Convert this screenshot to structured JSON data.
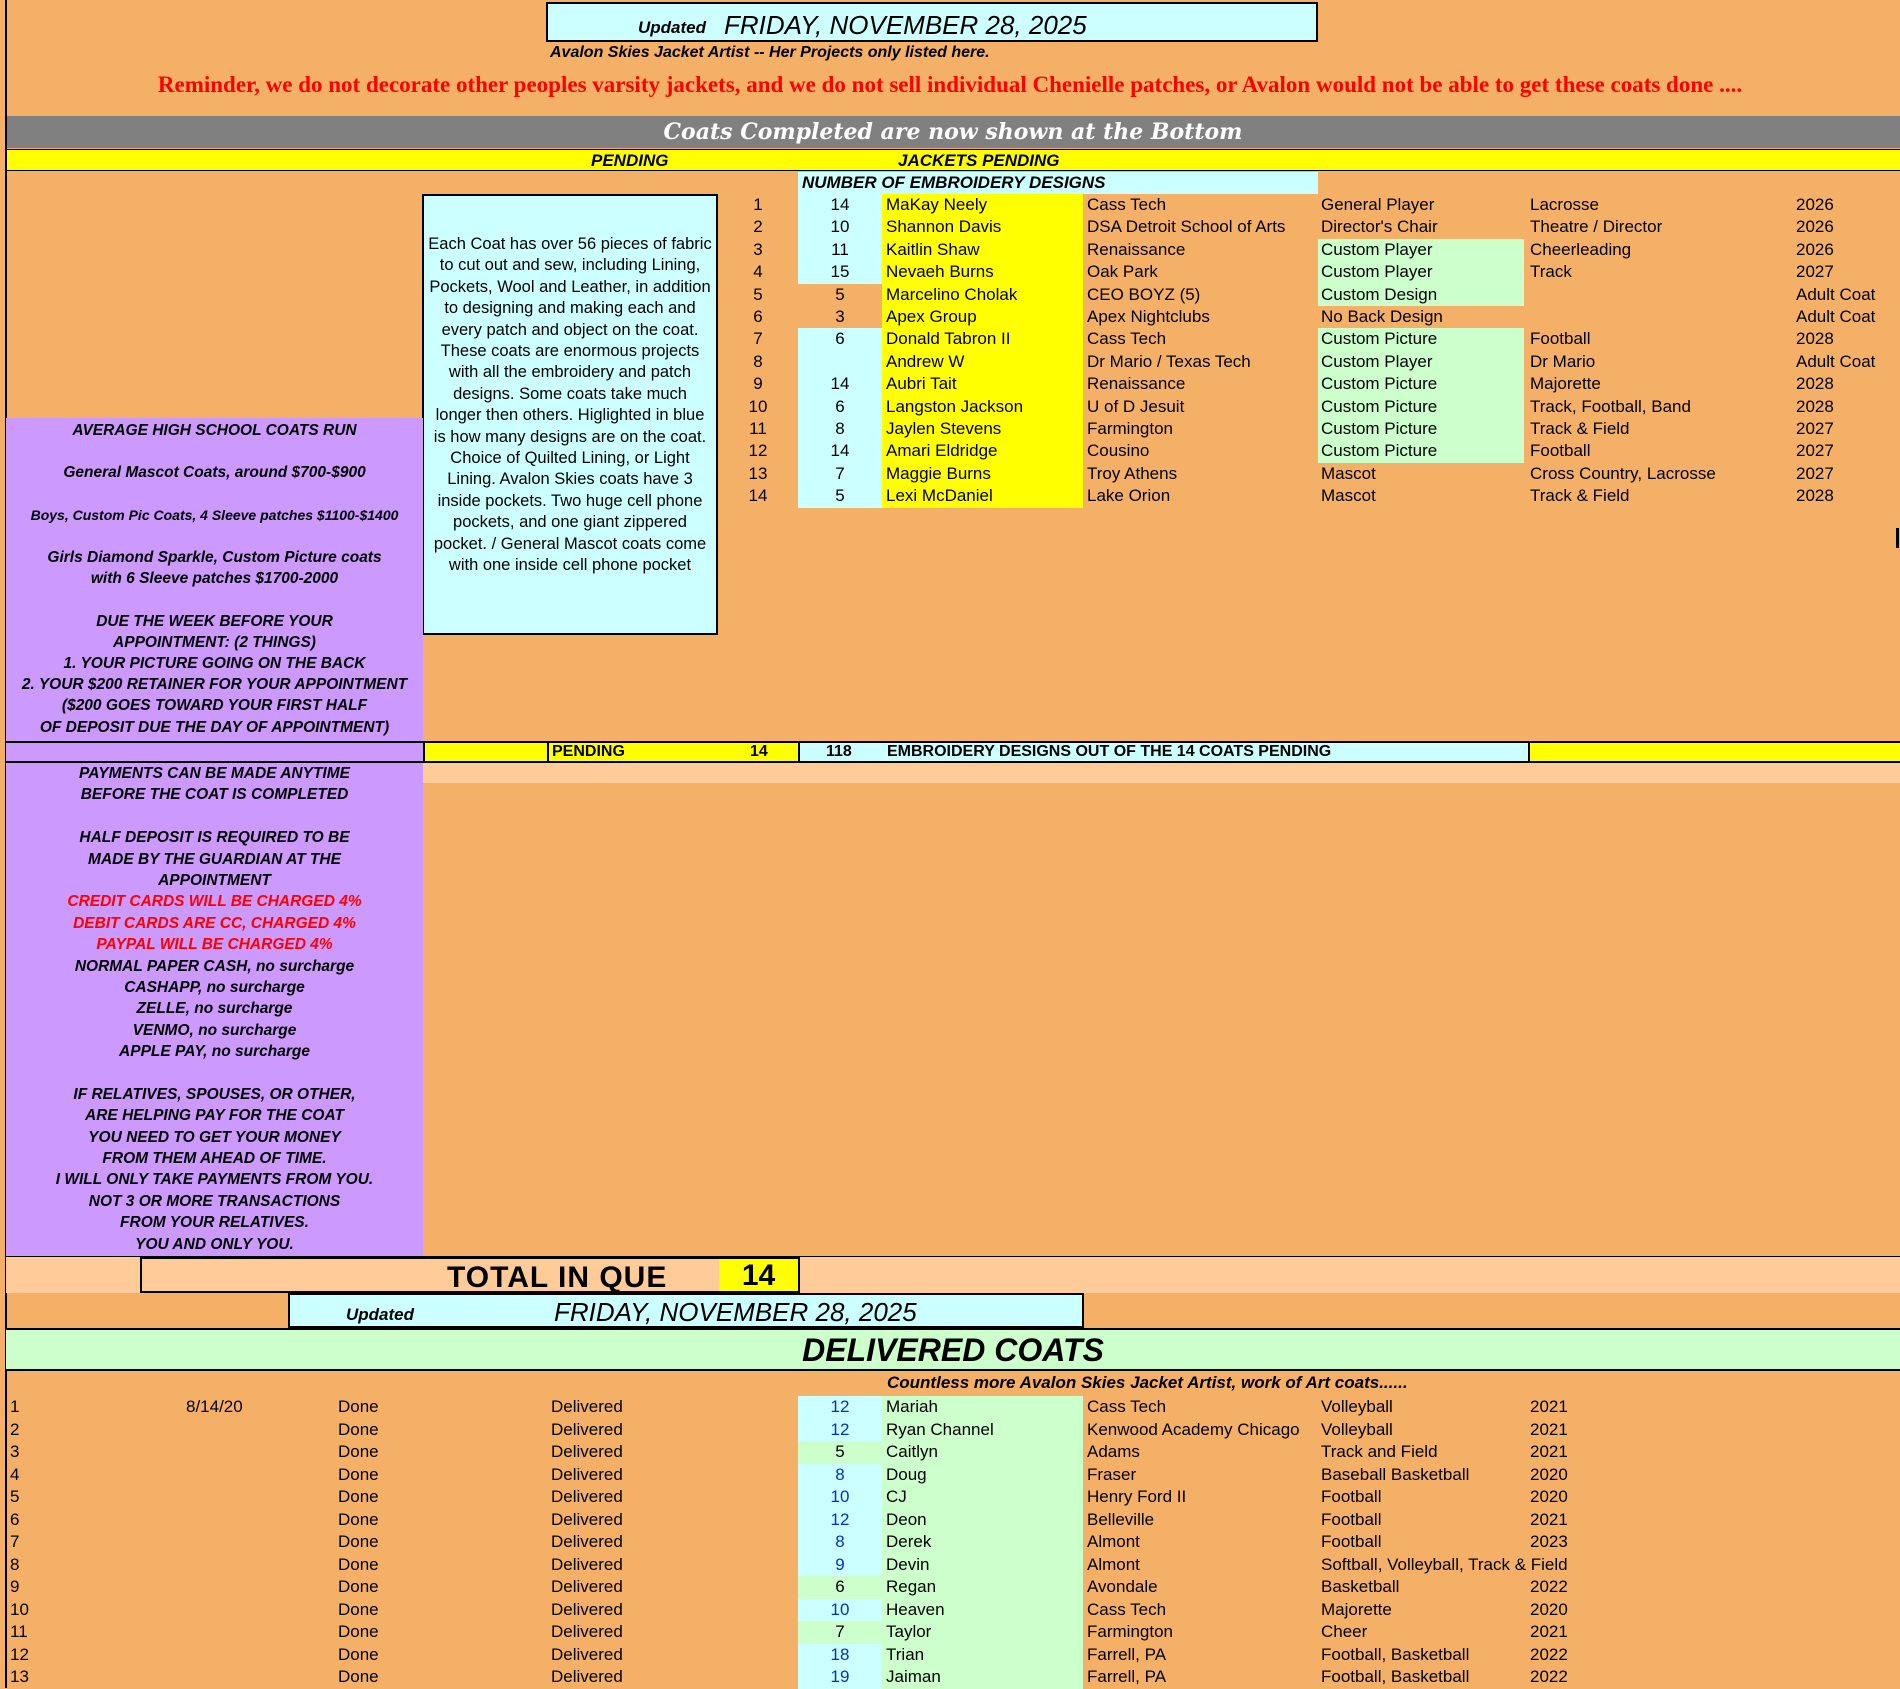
{
  "header": {
    "updated_label": "Updated",
    "updated_date": "FRIDAY, NOVEMBER 28, 2025",
    "subtitle": "Avalon Skies Jacket Artist -- Her Projects only listed here.",
    "reminder": "Reminder, we do not decorate other peoples varsity jackets, and we do not sell individual Chenielle patches, or Avalon would not be able to get these coats done ....",
    "banner": "Coats Completed are now shown at the Bottom"
  },
  "pending_header": {
    "left": "PENDING",
    "right": "JACKETS PENDING",
    "embroidery_label": "NUMBER OF EMBROIDERY DESIGNS"
  },
  "info_box": "Each Coat has over 56 pieces of fabric to cut out and sew, including Lining, Pockets, Wool and Leather, in addition to designing and making each and every patch and object on the coat.  These coats are enormous projects with all the embroidery and patch designs.  Some coats take much longer then others.  Higlighted in blue is how many designs are on the coat.  Choice of Quilted Lining, or Light Lining.  Avalon Skies coats have 3 inside pockets.  Two huge cell phone pockets, and one giant zippered pocket. / General Mascot coats come with one inside cell phone pocket",
  "prices": [
    "AVERAGE HIGH SCHOOL COATS RUN",
    "",
    "General Mascot Coats, around $700-$900",
    "",
    "Boys, Custom Pic Coats, 4 Sleeve patches $1100-$1400",
    "",
    "Girls Diamond Sparkle, Custom Picture coats",
    "with 6 Sleeve patches $1700-2000",
    "",
    "DUE THE WEEK BEFORE YOUR",
    "APPOINTMENT: (2 THINGS)",
    "1. YOUR PICTURE GOING ON THE BACK",
    "2. YOUR $200 RETAINER FOR YOUR APPOINTMENT",
    "($200 GOES TOWARD YOUR FIRST HALF",
    "OF DEPOSIT DUE THE DAY OF APPOINTMENT)"
  ],
  "pending_rows": [
    {
      "n": "1",
      "designs": "14",
      "name": "MaKay Neely",
      "school": "Cass Tech",
      "type": "General Player",
      "sport": "Lacrosse",
      "year": "2026",
      "hl_d": true,
      "hl_n": true,
      "hl_t": false
    },
    {
      "n": "2",
      "designs": "10",
      "name": "Shannon Davis",
      "school": "DSA  Detroit School of Arts",
      "type": "Director's Chair",
      "sport": "Theatre / Director",
      "year": "2026",
      "hl_d": true,
      "hl_n": true,
      "hl_t": false
    },
    {
      "n": "3",
      "designs": "11",
      "name": "Kaitlin Shaw",
      "school": "Renaissance",
      "type": "Custom Player",
      "sport": "Cheerleading",
      "year": "2026",
      "hl_d": true,
      "hl_n": true,
      "hl_t": true
    },
    {
      "n": "4",
      "designs": "15",
      "name": "Nevaeh Burns",
      "school": "Oak Park",
      "type": "Custom Player",
      "sport": "Track",
      "year": "2027",
      "hl_d": true,
      "hl_n": true,
      "hl_t": true
    },
    {
      "n": "5",
      "designs": "5",
      "name": "Marcelino Cholak",
      "school": "CEO BOYZ (5)",
      "type": "Custom  Design",
      "sport": "",
      "year": "Adult Coat",
      "hl_d": false,
      "hl_n": true,
      "hl_t": true
    },
    {
      "n": "6",
      "designs": "3",
      "name": "Apex Group",
      "school": "Apex Nightclubs",
      "type": "No Back Design",
      "sport": "",
      "year": "Adult Coat",
      "hl_d": false,
      "hl_n": true,
      "hl_t": false
    },
    {
      "n": "7",
      "designs": "6",
      "name": "Donald Tabron II",
      "school": "Cass Tech",
      "type": "Custom Picture",
      "sport": "Football",
      "year": "2028",
      "hl_d": true,
      "hl_n": true,
      "hl_t": true
    },
    {
      "n": "8",
      "designs": "",
      "name": "Andrew W",
      "school": "Dr Mario / Texas Tech",
      "type": "Custom Player",
      "sport": "Dr Mario",
      "year": "Adult Coat",
      "hl_d": true,
      "hl_n": true,
      "hl_t": true
    },
    {
      "n": "9",
      "designs": "14",
      "name": "Aubri Tait",
      "school": "Renaissance",
      "type": "Custom Picture",
      "sport": "Majorette",
      "year": "2028",
      "hl_d": true,
      "hl_n": true,
      "hl_t": true
    },
    {
      "n": "10",
      "designs": "6",
      "name": "Langston Jackson",
      "school": "U of D Jesuit",
      "type": "Custom Picture",
      "sport": "Track, Football, Band",
      "year": "2028",
      "hl_d": true,
      "hl_n": true,
      "hl_t": true
    },
    {
      "n": "11",
      "designs": "8",
      "name": "Jaylen Stevens",
      "school": "Farmington",
      "type": "Custom Picture",
      "sport": "Track & Field",
      "year": "2027",
      "hl_d": true,
      "hl_n": true,
      "hl_t": true
    },
    {
      "n": "12",
      "designs": "14",
      "name": "Amari Eldridge",
      "school": "Cousino",
      "type": "Custom Picture",
      "sport": "Football",
      "year": "2027",
      "hl_d": true,
      "hl_n": true,
      "hl_t": true
    },
    {
      "n": "13",
      "designs": "7",
      "name": "Maggie Burns",
      "school": "Troy Athens",
      "type": "Mascot",
      "sport": "Cross Country, Lacrosse",
      "year": "2027",
      "hl_d": true,
      "hl_n": true,
      "hl_t": false
    },
    {
      "n": "14",
      "designs": "5",
      "name": "Lexi McDaniel",
      "school": "Lake Orion",
      "type": "Mascot",
      "sport": "Track & Field",
      "year": "2028",
      "hl_d": true,
      "hl_n": true,
      "hl_t": false
    }
  ],
  "summary_row": {
    "label": "PENDING",
    "count": "14",
    "designs_total": "118",
    "designs_text": "EMBROIDERY DESIGNS OUT OF THE 14 COATS PENDING"
  },
  "payments": [
    {
      "t": "PAYMENTS CAN BE MADE ANYTIME",
      "red": false
    },
    {
      "t": "BEFORE THE COAT IS COMPLETED",
      "red": false
    },
    {
      "t": "",
      "red": false
    },
    {
      "t": "HALF DEPOSIT IS REQUIRED TO BE",
      "red": false
    },
    {
      "t": "MADE BY THE GUARDIAN AT THE",
      "red": false
    },
    {
      "t": "APPOINTMENT",
      "red": false
    },
    {
      "t": "CREDIT CARDS WILL BE CHARGED 4%",
      "red": true
    },
    {
      "t": "DEBIT CARDS ARE CC, CHARGED 4%",
      "red": true
    },
    {
      "t": "PAYPAL WILL BE CHARGED 4%",
      "red": true
    },
    {
      "t": "NORMAL PAPER CASH, no surcharge",
      "red": false
    },
    {
      "t": "CASHAPP, no surcharge",
      "red": false
    },
    {
      "t": "ZELLE, no surcharge",
      "red": false
    },
    {
      "t": "VENMO, no surcharge",
      "red": false
    },
    {
      "t": "APPLE PAY, no surcharge",
      "red": false
    },
    {
      "t": "",
      "red": false
    },
    {
      "t": "IF RELATIVES, SPOUSES, OR OTHER,",
      "red": false
    },
    {
      "t": "ARE HELPING PAY FOR THE COAT",
      "red": false
    },
    {
      "t": "YOU NEED TO GET YOUR MONEY",
      "red": false
    },
    {
      "t": "FROM THEM AHEAD OF TIME.",
      "red": false
    },
    {
      "t": "I WILL ONLY TAKE PAYMENTS FROM YOU.",
      "red": false
    },
    {
      "t": "NOT 3 OR MORE TRANSACTIONS",
      "red": false
    },
    {
      "t": "FROM YOUR RELATIVES.",
      "red": false
    },
    {
      "t": "YOU AND ONLY YOU.",
      "red": false
    }
  ],
  "total": {
    "label": "TOTAL IN QUE",
    "value": "14"
  },
  "updated2": {
    "label": "Updated",
    "date": "FRIDAY, NOVEMBER 28, 2025"
  },
  "delivered": {
    "title": "DELIVERED COATS",
    "subtitle": "Countless more Avalon Skies Jacket Artist, work of Art coats......",
    "rows": [
      {
        "n": "1",
        "date": "8/14/20",
        "status": "Done",
        "state": "Delivered",
        "designs": "12",
        "blue": true,
        "name": "Mariah",
        "school": "Cass Tech",
        "sport": "Volleyball",
        "year": "2021"
      },
      {
        "n": "2",
        "date": "",
        "status": "Done",
        "state": "Delivered",
        "designs": "12",
        "blue": true,
        "name": "Ryan Channel",
        "school": "Kenwood Academy Chicago",
        "sport": "Volleyball",
        "year": "2021"
      },
      {
        "n": "3",
        "date": "",
        "status": "Done",
        "state": "Delivered",
        "designs": "5",
        "blue": false,
        "name": "Caitlyn",
        "school": "Adams",
        "sport": "Track and Field",
        "year": "2021"
      },
      {
        "n": "4",
        "date": "",
        "status": "Done",
        "state": "Delivered",
        "designs": "8",
        "blue": true,
        "name": "Doug",
        "school": "Fraser",
        "sport": "Baseball Basketball",
        "year": "2020"
      },
      {
        "n": "5",
        "date": "",
        "status": "Done",
        "state": "Delivered",
        "designs": "10",
        "blue": true,
        "name": "CJ",
        "school": "Henry Ford II",
        "sport": "Football",
        "year": "2020"
      },
      {
        "n": "6",
        "date": "",
        "status": "Done",
        "state": "Delivered",
        "designs": "12",
        "blue": true,
        "name": "Deon",
        "school": "Belleville",
        "sport": "Football",
        "year": "2021"
      },
      {
        "n": "7",
        "date": "",
        "status": "Done",
        "state": "Delivered",
        "designs": "8",
        "blue": true,
        "name": "Derek",
        "school": "Almont",
        "sport": "Football",
        "year": "2023"
      },
      {
        "n": "8",
        "date": "",
        "status": "Done",
        "state": "Delivered",
        "designs": "9",
        "blue": true,
        "name": "Devin",
        "school": "Almont",
        "sport": "Softball, Volleyball, Track & Field",
        "year": ""
      },
      {
        "n": "9",
        "date": "",
        "status": "Done",
        "state": "Delivered",
        "designs": "6",
        "blue": false,
        "name": "Regan",
        "school": "Avondale",
        "sport": "Basketball",
        "year": "2022"
      },
      {
        "n": "10",
        "date": "",
        "status": "Done",
        "state": "Delivered",
        "designs": "10",
        "blue": true,
        "name": "Heaven",
        "school": "Cass Tech",
        "sport": "Majorette",
        "year": "2020"
      },
      {
        "n": "11",
        "date": "",
        "status": "Done",
        "state": "Delivered",
        "designs": "7",
        "blue": false,
        "name": "Taylor",
        "school": "Farmington",
        "sport": "Cheer",
        "year": "2021"
      },
      {
        "n": "12",
        "date": "",
        "status": "Done",
        "state": "Delivered",
        "designs": "18",
        "blue": true,
        "name": "Trian",
        "school": "Farrell, PA",
        "sport": "Football, Basketball",
        "year": "2022"
      },
      {
        "n": "13",
        "date": "",
        "status": "Done",
        "state": "Delivered",
        "designs": "19",
        "blue": true,
        "name": "Jaiman",
        "school": "Farrell, PA",
        "sport": "Football, Basketball",
        "year": "2022"
      }
    ]
  },
  "colors": {
    "background": "#f4b066",
    "yellow": "#ffff00",
    "cyan": "#ccffff",
    "green": "#ccffcc",
    "purple": "#cc99ff",
    "gray_banner": "#808080",
    "reminder_red": "#ff0000"
  }
}
